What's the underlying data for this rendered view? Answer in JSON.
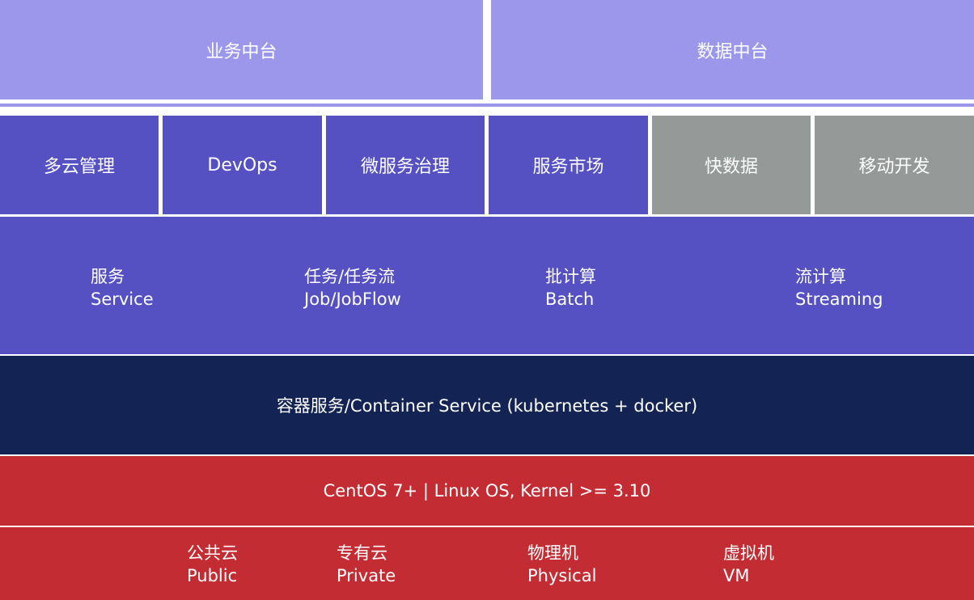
{
  "top": {
    "business_platform": "业务中台",
    "data_platform": "数据中台"
  },
  "capabilities": [
    {
      "label": "多云管理"
    },
    {
      "label": "DevOps"
    },
    {
      "label": "微服务治理"
    },
    {
      "label": "服务市场"
    },
    {
      "label": "快数据"
    },
    {
      "label": "移动开发"
    }
  ],
  "workloads": [
    {
      "zh": "服务",
      "en": "Service"
    },
    {
      "zh": "任务/任务流",
      "en": "Job/JobFlow"
    },
    {
      "zh": "批计算",
      "en": "Batch"
    },
    {
      "zh": "流计算",
      "en": "Streaming"
    }
  ],
  "container": {
    "label": "容器服务/Container Service (kubernetes + docker)"
  },
  "os": {
    "label": "CentOS 7+ | Linux OS, Kernel >= 3.10"
  },
  "infrastructure": [
    {
      "zh": "公共云",
      "en": "Public"
    },
    {
      "zh": "专有云",
      "en": "Private"
    },
    {
      "zh": "物理机",
      "en": "Physical"
    },
    {
      "zh": "虚拟机",
      "en": "VM"
    }
  ],
  "colors": {
    "top_layer": "#9b98ec",
    "capability_layer": "#5551c3",
    "capability_muted": "#959a99",
    "container_layer": "#132454",
    "os_layer": "#c42c33"
  }
}
